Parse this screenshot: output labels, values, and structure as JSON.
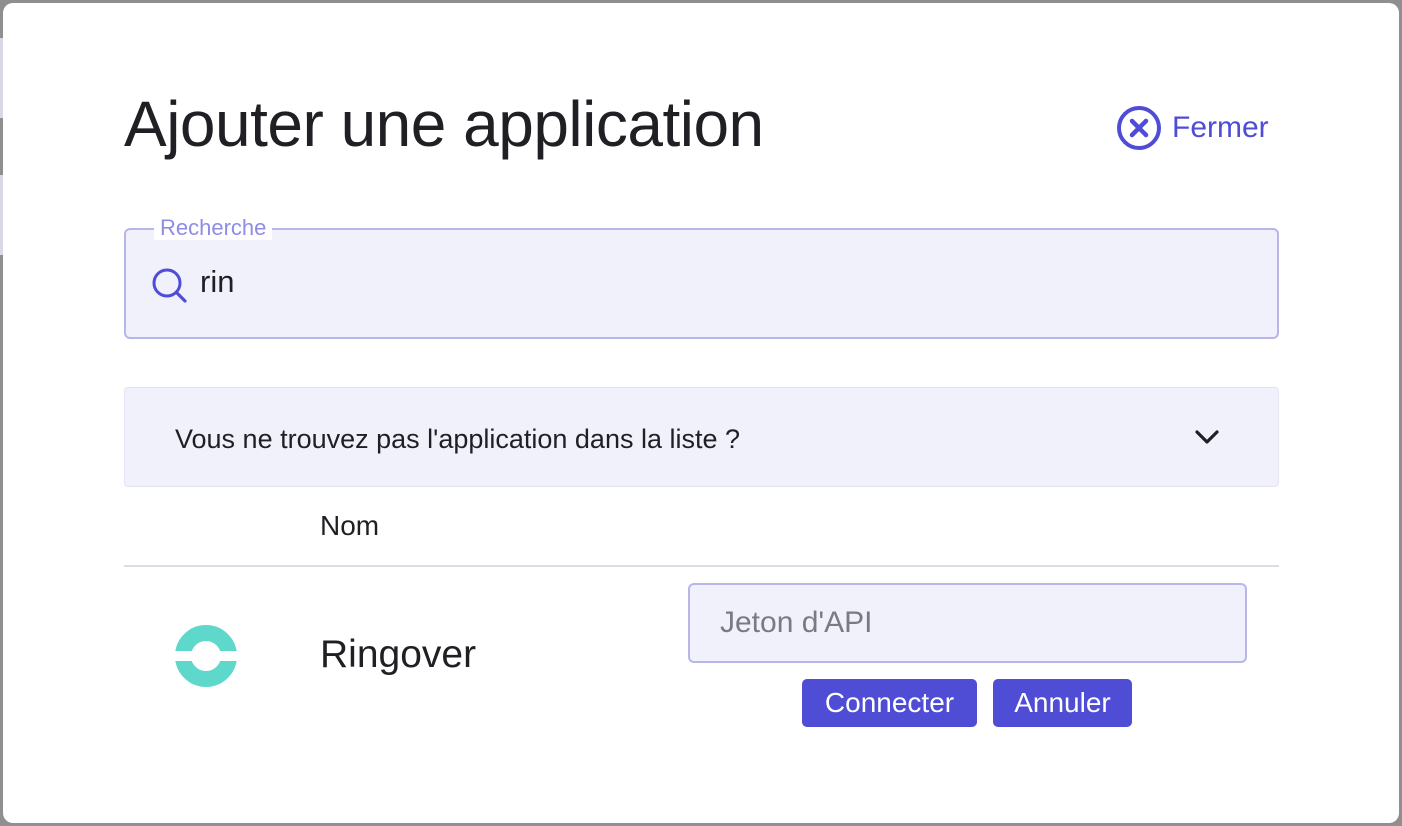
{
  "modal": {
    "title": "Ajouter une application",
    "close_label": "Fermer"
  },
  "search": {
    "legend": "Recherche",
    "value": "rin"
  },
  "accordion": {
    "label": "Vous ne trouvez pas l'application dans la liste ?"
  },
  "table": {
    "columns": [
      "",
      "Nom",
      ""
    ],
    "rows": [
      {
        "name": "Ringover",
        "logo": "ringover-logo",
        "token_placeholder": "Jeton d'API",
        "connect_label": "Connecter",
        "cancel_label": "Annuler"
      }
    ]
  },
  "colors": {
    "accent": "#4f4cd6",
    "field_bg": "#f1f1fc",
    "field_border": "#b7b5ea",
    "logo": "#5fd8cc"
  },
  "icons": {
    "close": "close-circle-icon",
    "search": "search-icon",
    "chevron": "chevron-down-icon"
  }
}
